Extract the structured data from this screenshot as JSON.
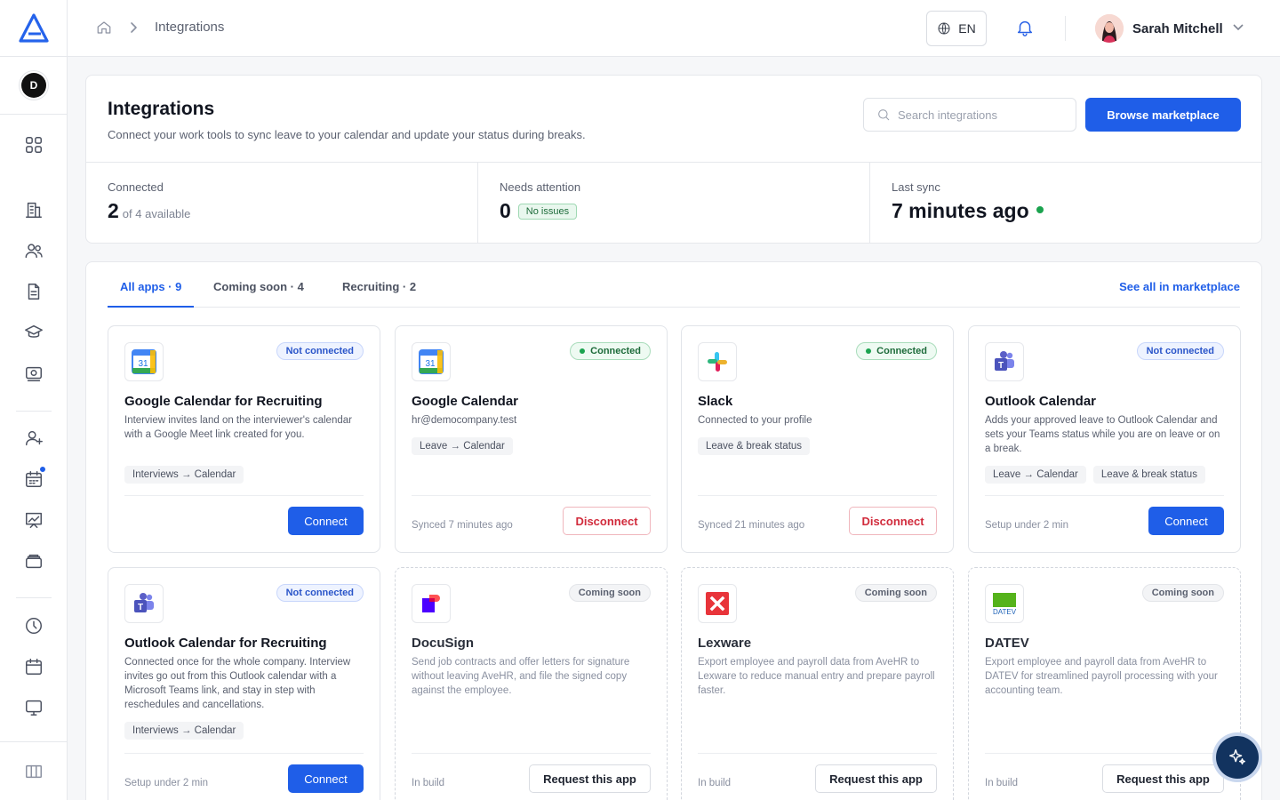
{
  "header": {
    "breadcrumb": "Integrations",
    "language": "EN",
    "user_name": "Sarah Mitchell"
  },
  "sidebar": {
    "workspace_initial": "D",
    "items": [
      {
        "icon": "grid-icon"
      },
      {
        "icon": "building-icon"
      },
      {
        "icon": "users-icon"
      },
      {
        "icon": "document-icon"
      },
      {
        "icon": "graduation-cap-icon"
      },
      {
        "icon": "money-icon"
      },
      {
        "icon": "add-user-icon"
      },
      {
        "icon": "calendar-grid-icon",
        "has_notification": true
      },
      {
        "icon": "chart-board-icon"
      },
      {
        "icon": "layers-icon"
      },
      {
        "icon": "clock-icon"
      },
      {
        "icon": "calendar-icon"
      },
      {
        "icon": "monitor-icon"
      },
      {
        "icon": "panel-toggle-icon"
      }
    ]
  },
  "page": {
    "title": "Integrations",
    "subtitle": "Connect your work tools to sync leave to your calendar and update your status during breaks.",
    "search_placeholder": "Search integrations",
    "browse_label": "Browse marketplace"
  },
  "stats": {
    "connected_label": "Connected",
    "connected_value": "2",
    "connected_suffix": "of 4 available",
    "attention_label": "Needs attention",
    "attention_value": "0",
    "attention_badge": "No issues",
    "sync_label": "Last sync",
    "sync_value": "7 minutes ago"
  },
  "tabs": {
    "all": "All apps · 9",
    "soon": "Coming soon · 4",
    "recruiting": "Recruiting · 2",
    "see_all": "See all in marketplace"
  },
  "apps": [
    {
      "name": "Google Calendar for Recruiting",
      "status": "Not connected",
      "desc": "Interview invites land on the interviewer's calendar with a Google Meet link created for you.",
      "chips": [
        "Interviews → Calendar"
      ],
      "footer": "",
      "action": "Connect"
    },
    {
      "name": "Google Calendar",
      "status": "Connected",
      "desc": "hr@democompany.test",
      "chips": [
        "Leave → Calendar"
      ],
      "footer": "Synced 7 minutes ago",
      "action": "Disconnect"
    },
    {
      "name": "Slack",
      "status": "Connected",
      "desc": "Connected to your profile",
      "chips": [
        "Leave & break status"
      ],
      "footer": "Synced 21 minutes ago",
      "action": "Disconnect"
    },
    {
      "name": "Outlook Calendar",
      "status": "Not connected",
      "desc": "Adds your approved leave to Outlook Calendar and sets your Teams status while you are on leave or on a break.",
      "chips": [
        "Leave → Calendar",
        "Leave & break status"
      ],
      "footer": "Setup under 2 min",
      "action": "Connect"
    },
    {
      "name": "Outlook Calendar for Recruiting",
      "status": "Not connected",
      "desc": "Connected once for the whole company. Interview invites go out from this Outlook calendar with a Microsoft Teams link, and stay in step with reschedules and cancellations.",
      "chips": [
        "Interviews → Calendar"
      ],
      "footer": "Setup under 2 min",
      "action": "Connect"
    },
    {
      "name": "DocuSign",
      "status": "Coming soon",
      "desc": "Send job contracts and offer letters for signature without leaving AveHR, and file the signed copy against the employee.",
      "chips": [],
      "footer": "In build",
      "action": "Request this app"
    },
    {
      "name": "Lexware",
      "status": "Coming soon",
      "desc": "Export employee and payroll data from AveHR to Lexware to reduce manual entry and prepare payroll faster.",
      "chips": [],
      "footer": "In build",
      "action": "Request this app"
    },
    {
      "name": "DATEV",
      "status": "Coming soon",
      "desc": "Export employee and payroll data from AveHR to DATEV for streamlined payroll processing with your accounting team.",
      "chips": [],
      "footer": "In build",
      "action": "Request this app",
      "logo_text": "DATEV"
    }
  ],
  "logo_text": {
    "calendar_day": "31"
  },
  "colors": {
    "primary": "#1f5ee8",
    "success": "#1ba34f",
    "danger": "#d12b3c",
    "fab": "#12335f"
  }
}
